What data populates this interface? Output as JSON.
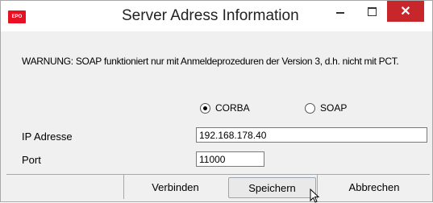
{
  "window": {
    "title": "Server Adress Information",
    "icon_label": "EPO",
    "close_glyph": "✕"
  },
  "warning_text": "WARNUNG: SOAP funktioniert nur mit Anmeldeprozeduren der Version 3, d.h. nicht mit PCT.",
  "protocol": {
    "options": [
      {
        "label": "CORBA",
        "checked": true
      },
      {
        "label": "SOAP",
        "checked": false
      }
    ]
  },
  "ip": {
    "label": "IP Adresse",
    "value": "192.168.178.40"
  },
  "port": {
    "label": "Port",
    "value": "11000"
  },
  "buttons": {
    "connect": "Verbinden",
    "save": "Speichern",
    "cancel": "Abbrechen"
  },
  "colors": {
    "close_button": "#c7262b",
    "app_icon": "#e81123"
  }
}
